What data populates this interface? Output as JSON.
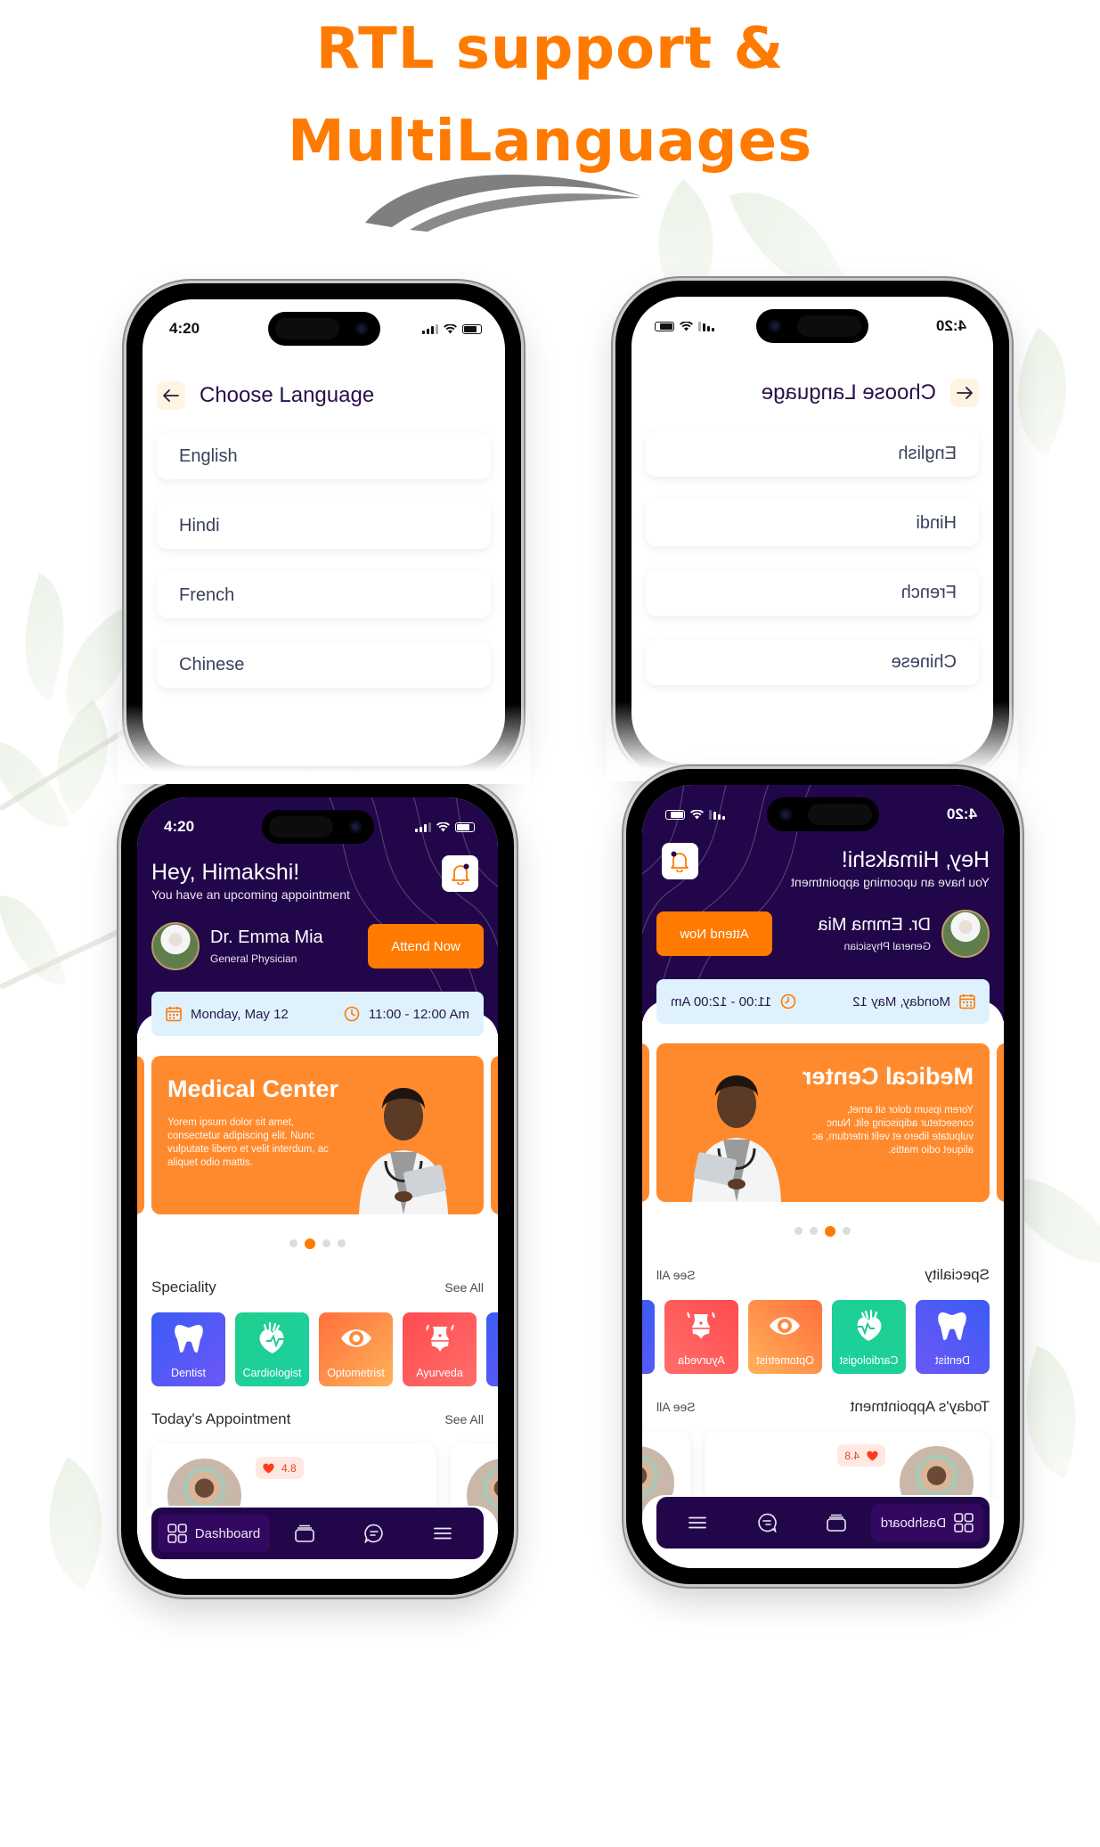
{
  "headline": {
    "line1": "RTL support &",
    "line2": "MultiLanguages"
  },
  "colors": {
    "accent_orange": "#ff7a00",
    "brand_purple": "#22064a",
    "banner_orange": "#ff8a2d",
    "date_bar_blue": "#dff1fd"
  },
  "status_bar": {
    "time": "4:20",
    "icons": [
      "signal-icon",
      "wifi-icon",
      "battery-icon"
    ]
  },
  "language_screen": {
    "back_icon": "arrow-left-icon",
    "title": "Choose Language",
    "languages": [
      "English",
      "Hindi",
      "French",
      "Chinese"
    ]
  },
  "dashboard": {
    "greeting": "Hey, Himakshi!",
    "subtitle": "You have an upcoming appointment",
    "bell_icon": "bell-icon",
    "doctor": {
      "name": "Dr. Emma Mia",
      "role": "General Physician"
    },
    "attend_label": "Attend Now",
    "date": "Monday, May 12",
    "time_range": "11:00 - 12:00 Am",
    "banner": {
      "title": "Medical Center",
      "text": "Yorem ipsum dolor sit amet, consectetur adipiscing elit. Nunc vulputate libero et velit interdum, ac aliquet odio mattis."
    },
    "carousel": {
      "count": 4,
      "active_index": 1
    },
    "speciality": {
      "title": "Speciality",
      "see_all": "See All",
      "items": [
        {
          "label": "Dentist",
          "icon": "tooth-icon",
          "color": "#4f56f2"
        },
        {
          "label": "Cardiologist",
          "icon": "heart-icon",
          "color": "#1dcc93"
        },
        {
          "label": "Optometrist",
          "icon": "eye-icon",
          "color": "#ff8a3c"
        },
        {
          "label": "Ayurveda",
          "icon": "body-icon",
          "color": "#ff4f55"
        }
      ]
    },
    "appointments": {
      "title": "Today's Appointment",
      "see_all": "See All",
      "items": [
        {
          "rating": "4.8"
        }
      ]
    },
    "nav": [
      {
        "label": "Dashboard",
        "icon": "grid-icon",
        "active": true
      },
      {
        "label": "",
        "icon": "wallet-icon",
        "active": false
      },
      {
        "label": "",
        "icon": "chat-icon",
        "active": false
      },
      {
        "label": "",
        "icon": "menu-icon",
        "active": false
      }
    ]
  },
  "variants": [
    {
      "name": "ltr",
      "direction": "LTR"
    },
    {
      "name": "rtl",
      "direction": "RTL"
    }
  ]
}
